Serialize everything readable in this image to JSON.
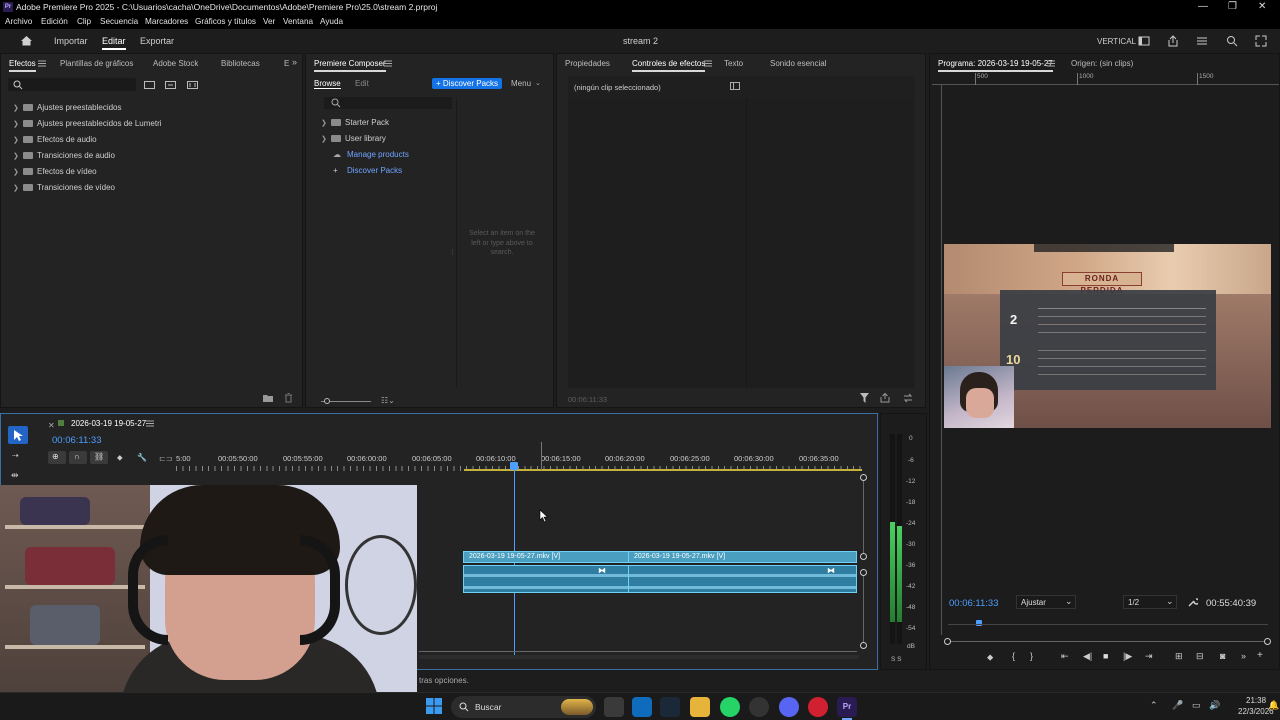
{
  "app": {
    "title": "Adobe Premiere Pro 2025 - C:\\Usuarios\\cacha\\OneDrive\\Documentos\\Adobe\\Premiere Pro\\25.0\\stream 2.prproj",
    "icon_text": "Pr"
  },
  "window_controls": {
    "minimize": "—",
    "maximize": "❐",
    "close": "✕"
  },
  "menu": [
    "Archivo",
    "Edición",
    "Clip",
    "Secuencia",
    "Marcadores",
    "Gráficos y títulos",
    "Ver",
    "Ventana",
    "Ayuda"
  ],
  "workspace": {
    "importar": "Importar",
    "editar": "Editar",
    "exportar": "Exportar",
    "project": "stream 2",
    "vertical": "VERTICAL"
  },
  "effects_panel": {
    "tabs": [
      "Efectos",
      "Plantillas de gráficos",
      "Adobe Stock",
      "Bibliotecas",
      "E"
    ],
    "items": [
      "Ajustes preestablecidos",
      "Ajustes preestablecidos de Lumetri",
      "Efectos de audio",
      "Transiciones de audio",
      "Efectos de vídeo",
      "Transiciones de vídeo"
    ]
  },
  "composer": {
    "title": "Premiere Composer",
    "tab_browse": "Browse",
    "tab_edit": "Edit",
    "discover_btn": "+ Discover Packs",
    "menu": "Menu",
    "items": [
      "Starter Pack",
      "User library"
    ],
    "manage": "Manage products",
    "discover": "Discover Packs",
    "hint": "Select an item on the left or type above to search."
  },
  "effect_controls": {
    "tabs": [
      "Propiedades",
      "Controles de efectos",
      "Texto",
      "Sonido esencial"
    ],
    "no_clip": "(ningún clip seleccionado)",
    "timecode": "00:06:11:33"
  },
  "program": {
    "title": "Programa: 2026-03-19 19-05-27",
    "origin": "Origen: (sin clips)",
    "ruler": [
      "500",
      "1000",
      "1500"
    ],
    "timecode": "00:06:11:33",
    "fit": "Ajustar",
    "quality": "1/2",
    "duration": "00:55:40:39",
    "game_banner": "RONDA PERDIDA",
    "score_a": "2",
    "score_b": "10"
  },
  "timeline": {
    "sequence": "2026-03-19 19-05-27",
    "timecode": "00:06:11:33",
    "ticks": [
      "5:00",
      "00:05:50:00",
      "00:05:55:00",
      "00:06:00:00",
      "00:06:05:00",
      "00:06:10:00",
      "00:06:15:00",
      "00:06:20:00",
      "00:06:25:00",
      "00:06:30:00",
      "00:06:35:00"
    ],
    "clip1": "2026-03-19 19-05-27.mkv [V]",
    "clip2": "2026-03-19 19-05-27.mkv [V]"
  },
  "meter": {
    "labels": [
      "0",
      "-6",
      "-12",
      "-18",
      "-24",
      "-30",
      "-36",
      "-42",
      "-48",
      "-54",
      "dB"
    ],
    "ss": "S S"
  },
  "status": {
    "text": "tras opciones."
  },
  "taskbar": {
    "search": "Buscar",
    "time": "21:38",
    "date": "22/3/2026"
  },
  "colors": {
    "accent": "#1473e6",
    "clip": "#2f7da0",
    "playhead": "#4d9eff",
    "meter": "#3dbb4a"
  }
}
